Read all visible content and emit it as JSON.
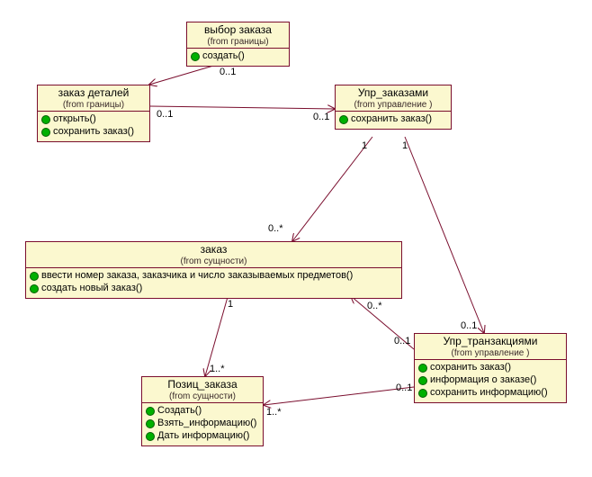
{
  "classes": {
    "order_select": {
      "title": "выбор заказа",
      "stereo": "(from границы)",
      "methods": [
        "создать()"
      ]
    },
    "order_details": {
      "title": "заказ деталей",
      "stereo": "(from границы)",
      "methods": [
        "открыть()",
        "сохранить заказ()"
      ]
    },
    "order_mgr": {
      "title": "Упр_заказами",
      "stereo": "(from управление )",
      "methods": [
        "сохранить заказ()"
      ]
    },
    "order": {
      "title": "заказ",
      "stereo": "(from сущности)",
      "methods": [
        "ввести номер заказа, заказчика и число заказываемых предметов()",
        "создать новый заказ()"
      ]
    },
    "txn_mgr": {
      "title": "Упр_транзакциями",
      "stereo": "(from управление )",
      "methods": [
        "сохранить заказ()",
        "информация о заказе()",
        "сохранить информацию()"
      ]
    },
    "order_pos": {
      "title": "Позиц_заказа",
      "stereo": "(from сущности)",
      "methods": [
        "Создать()",
        "Взять_информацию()",
        "Дать информацию()"
      ]
    }
  },
  "mult": {
    "sel_det": "0..1",
    "det_mgr_left": "0..1",
    "det_mgr_right": "0..1",
    "mgr_order_top": "1",
    "mgr_order_mid": "0..*",
    "order_txn_left": "0..*",
    "order_txn_right": "0..1",
    "mgr_txn_top": "1",
    "mgr_txn_bot": "0..1",
    "order_pos_top": "1",
    "order_pos_bot": "1..*",
    "txn_pos_right": "0..1",
    "txn_pos_left": "1..*"
  },
  "chart_data": {
    "type": "table",
    "diagram_type": "UML class diagram",
    "classes": [
      {
        "name": "выбор заказа",
        "package": "границы",
        "operations": [
          "создать()"
        ]
      },
      {
        "name": "заказ деталей",
        "package": "границы",
        "operations": [
          "открыть()",
          "сохранить заказ()"
        ]
      },
      {
        "name": "Упр_заказами",
        "package": "управление",
        "operations": [
          "сохранить заказ()"
        ]
      },
      {
        "name": "заказ",
        "package": "сущности",
        "operations": [
          "ввести номер заказа, заказчика и число заказываемых предметов()",
          "создать новый заказ()"
        ]
      },
      {
        "name": "Упр_транзакциями",
        "package": "управление",
        "operations": [
          "сохранить заказ()",
          "информация о заказе()",
          "сохранить информацию()"
        ]
      },
      {
        "name": "Позиц_заказа",
        "package": "сущности",
        "operations": [
          "Создать()",
          "Взять_информацию()",
          "Дать информацию()"
        ]
      }
    ],
    "associations": [
      {
        "end_a": "выбор заказа",
        "mult_a": "0..1",
        "end_b": "заказ деталей",
        "mult_b": "",
        "navigable_to": "заказ деталей"
      },
      {
        "end_a": "заказ деталей",
        "mult_a": "0..1",
        "end_b": "Упр_заказами",
        "mult_b": "0..1",
        "navigable_to": "Упр_заказами"
      },
      {
        "end_a": "Упр_заказами",
        "mult_a": "1",
        "end_b": "заказ",
        "mult_b": "0..*",
        "navigable_to": "заказ"
      },
      {
        "end_a": "Упр_заказами",
        "mult_a": "1",
        "end_b": "Упр_транзакциями",
        "mult_b": "0..1",
        "navigable_to": "Упр_транзакциями"
      },
      {
        "end_a": "Упр_транзакциями",
        "mult_a": "0..1",
        "end_b": "заказ",
        "mult_b": "0..*",
        "navigable_to": "заказ"
      },
      {
        "end_a": "заказ",
        "mult_a": "1",
        "end_b": "Позиц_заказа",
        "mult_b": "1..*",
        "navigable_to": "Позиц_заказа"
      },
      {
        "end_a": "Упр_транзакциями",
        "mult_a": "0..1",
        "end_b": "Позиц_заказа",
        "mult_b": "1..*",
        "navigable_to": "Позиц_заказа"
      }
    ]
  }
}
